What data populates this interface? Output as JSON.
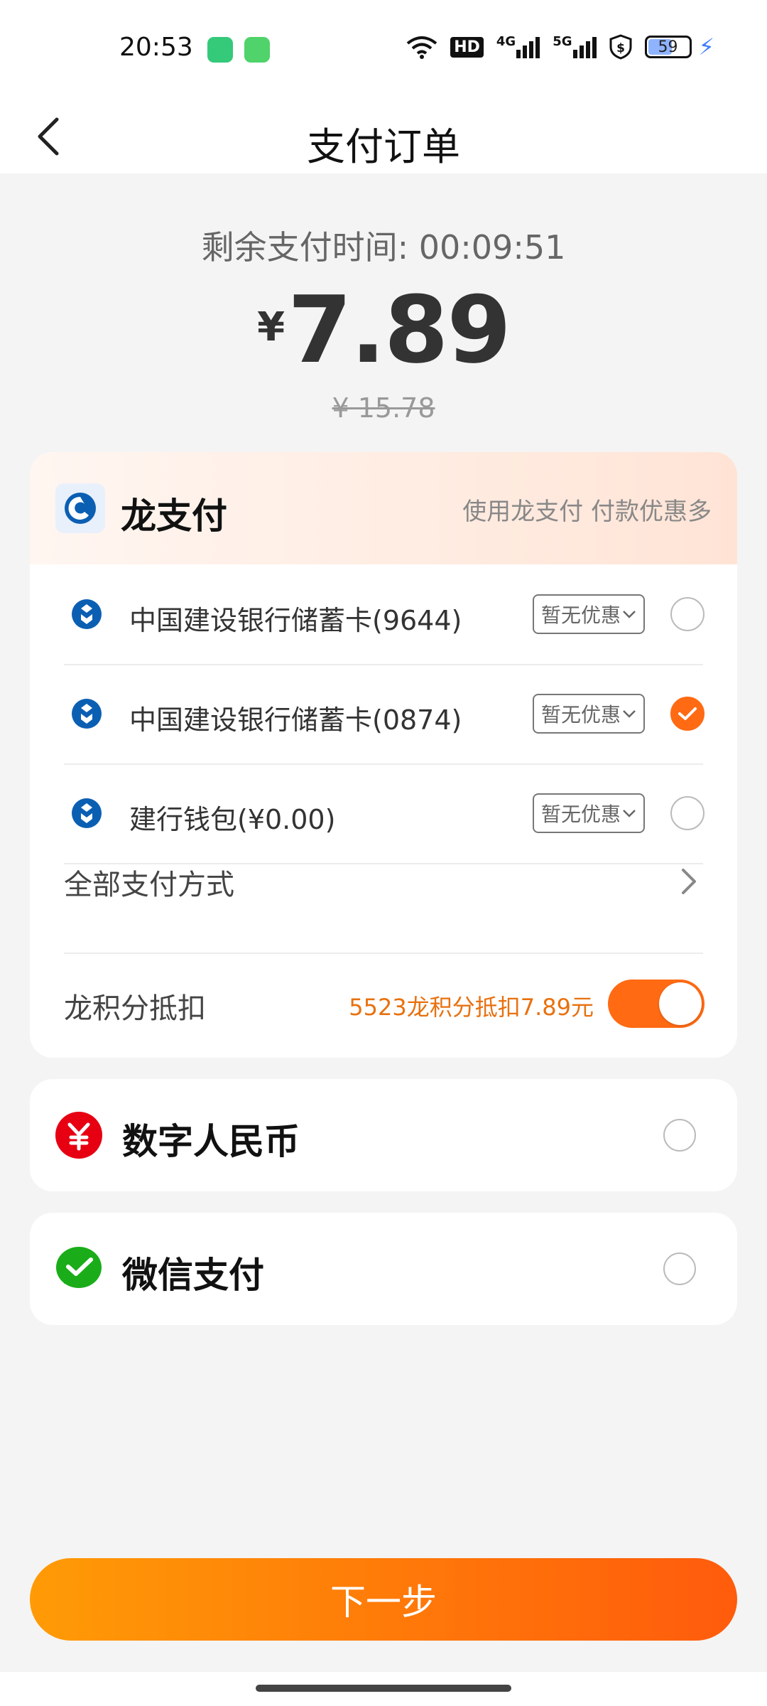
{
  "status_bar": {
    "time": "20:53",
    "battery": "59",
    "icons": [
      "wifi-icon",
      "hd-icon",
      "signal-4g-icon",
      "signal-5g-icon",
      "shield-dollar-icon",
      "battery-icon",
      "charging-icon"
    ],
    "hd_label": "HD",
    "sig4g_label": "4G",
    "sig5g_label": "5G"
  },
  "header": {
    "title": "支付订单"
  },
  "summary": {
    "timer_label": "剩余支付时间:",
    "timer_value": "00:09:51",
    "currency": "¥",
    "amount": "7.89",
    "original_price": "¥ 15.78"
  },
  "long_pay": {
    "title": "龙支付",
    "promo": "使用龙支付 付款优惠多",
    "methods": [
      {
        "label": "中国建设银行储蓄卡(9644)",
        "tag": "暂无优惠",
        "selected": false
      },
      {
        "label": "中国建设银行储蓄卡(0874)",
        "tag": "暂无优惠",
        "selected": true
      },
      {
        "label": "建行钱包(¥0.00)",
        "tag": "暂无优惠",
        "selected": false
      }
    ],
    "all_methods_label": "全部支付方式",
    "points_label": "龙积分抵扣",
    "points_text": "5523龙积分抵扣7.89元",
    "points_enabled": true
  },
  "other_methods": [
    {
      "label": "数字人民币",
      "icon": "ecny-icon",
      "color": "#e60012"
    },
    {
      "label": "微信支付",
      "icon": "wechat-pay-icon",
      "color": "#1aad19"
    }
  ],
  "colors": {
    "accent": "#ff6a13",
    "points_text": "#e8710f"
  },
  "next_button": {
    "label": "下一步"
  }
}
